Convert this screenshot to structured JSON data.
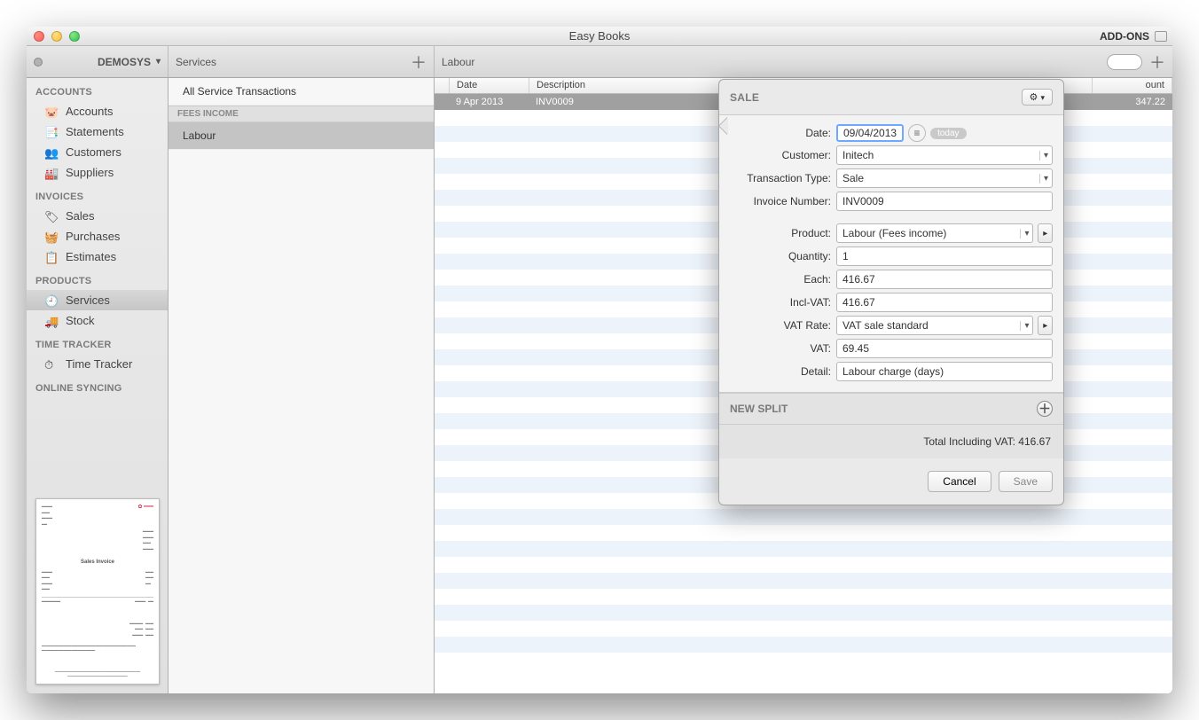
{
  "window": {
    "title": "Easy Books",
    "right_label": "ADD-ONS"
  },
  "toolbar": {
    "business_name": "DEMOSYS",
    "col2_title": "Services",
    "col3_title": "Labour"
  },
  "sidebar": {
    "sections": [
      {
        "label": "ACCOUNTS",
        "items": [
          {
            "icon": "piggy",
            "label": "Accounts"
          },
          {
            "icon": "statements",
            "label": "Statements"
          },
          {
            "icon": "customers",
            "label": "Customers"
          },
          {
            "icon": "suppliers",
            "label": "Suppliers"
          }
        ]
      },
      {
        "label": "INVOICES",
        "items": [
          {
            "icon": "tag",
            "label": "Sales"
          },
          {
            "icon": "basket",
            "label": "Purchases"
          },
          {
            "icon": "clipboard",
            "label": "Estimates"
          }
        ]
      },
      {
        "label": "PRODUCTS",
        "items": [
          {
            "icon": "clock",
            "label": "Services",
            "selected": true
          },
          {
            "icon": "truck",
            "label": "Stock"
          }
        ]
      },
      {
        "label": "TIME TRACKER",
        "items": [
          {
            "icon": "stopwatch",
            "label": "Time Tracker"
          }
        ]
      },
      {
        "label": "ONLINE SYNCING",
        "items": []
      }
    ]
  },
  "services": {
    "all_label": "All Service Transactions",
    "groups": [
      {
        "name": "FEES INCOME",
        "items": [
          {
            "label": "Labour",
            "selected": true
          }
        ]
      }
    ]
  },
  "table": {
    "headers": {
      "date": "Date",
      "description": "Description",
      "amount": "ount"
    },
    "rows": [
      {
        "date": "9 Apr 2013",
        "description": "INV0009",
        "amount": "347.22",
        "selected": true
      }
    ]
  },
  "popover": {
    "title": "SALE",
    "today_label": "today",
    "fields": {
      "date_label": "Date:",
      "date_value": "09/04/2013",
      "customer_label": "Customer:",
      "customer_value": "Initech",
      "txtype_label": "Transaction Type:",
      "txtype_value": "Sale",
      "invno_label": "Invoice Number:",
      "invno_value": "INV0009",
      "product_label": "Product:",
      "product_value": "Labour  (Fees income)",
      "qty_label": "Quantity:",
      "qty_value": "1",
      "each_label": "Each:",
      "each_value": "416.67",
      "inclvat_label": "Incl-VAT:",
      "inclvat_value": "416.67",
      "vatrate_label": "VAT Rate:",
      "vatrate_value": "VAT sale standard",
      "vat_label": "VAT:",
      "vat_value": "69.45",
      "detail_label": "Detail:",
      "detail_value": "Labour charge (days)"
    },
    "new_split_label": "NEW SPLIT",
    "total_label": "Total Including VAT: 416.67",
    "cancel": "Cancel",
    "save": "Save"
  },
  "preview": {
    "title": "Sales Invoice"
  }
}
